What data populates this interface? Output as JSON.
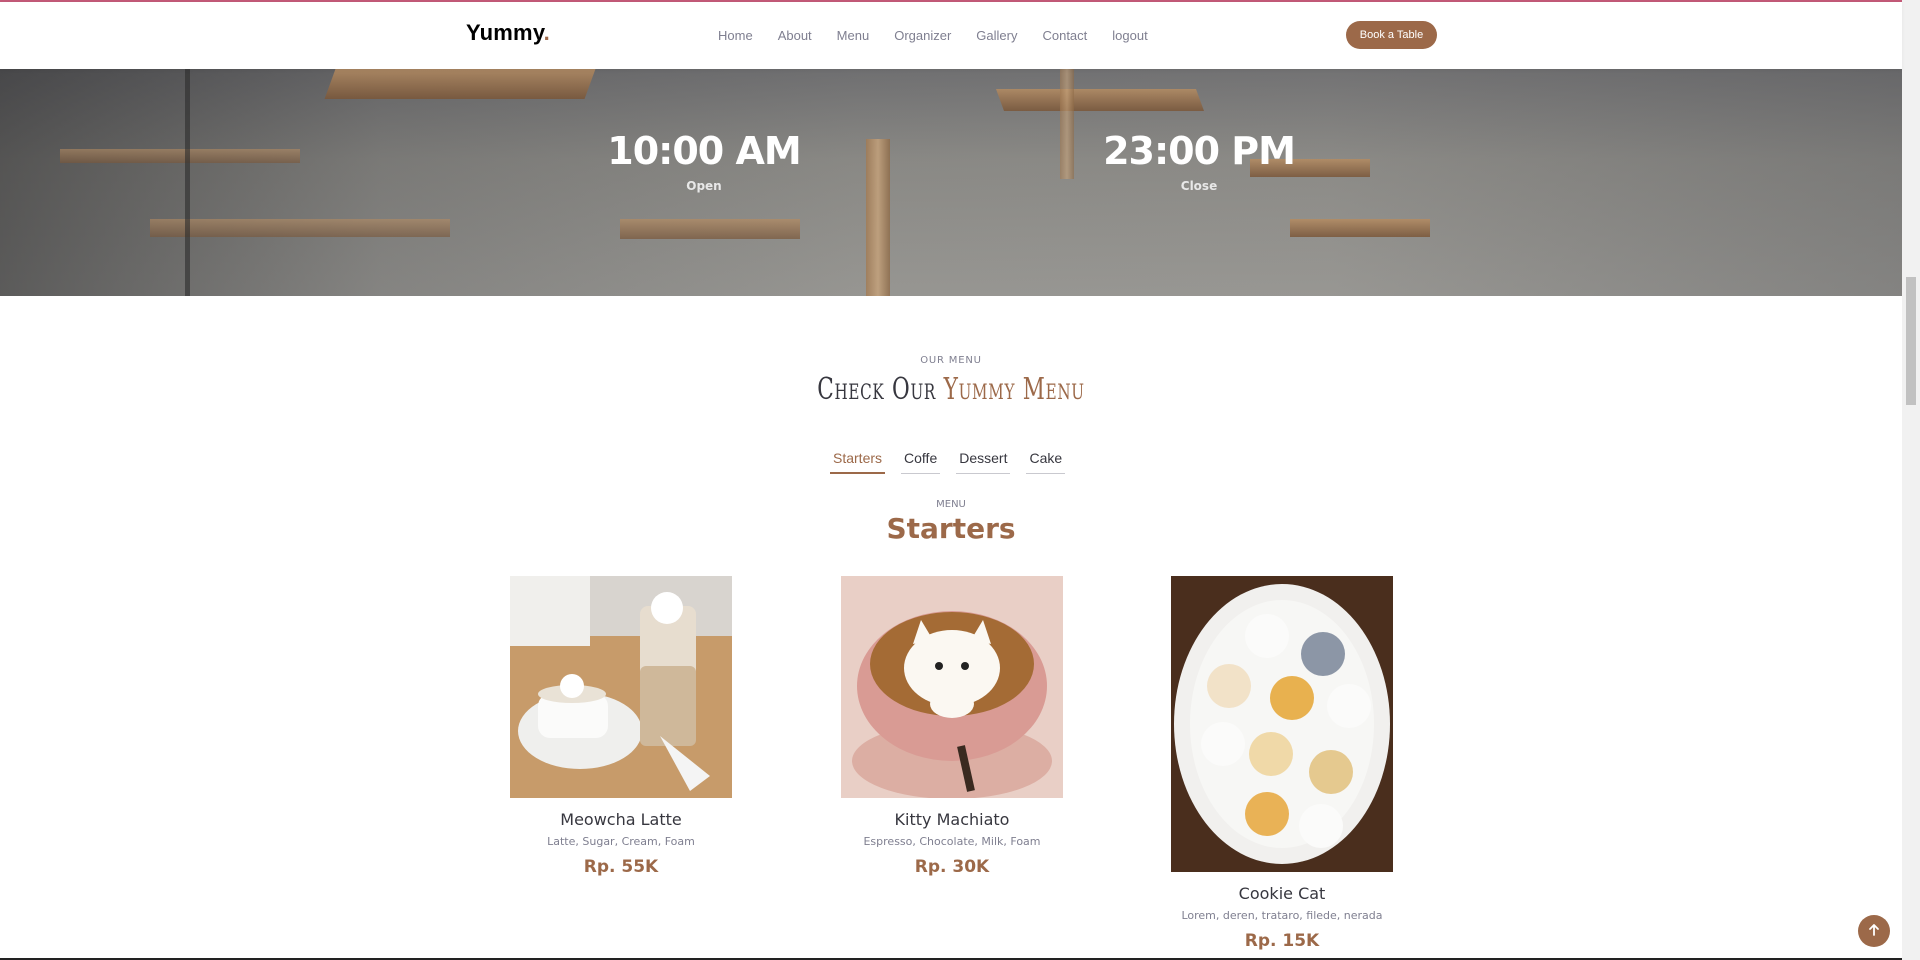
{
  "header": {
    "logo_text": "Yummy",
    "logo_dot": ".",
    "nav": [
      {
        "label": "Home"
      },
      {
        "label": "About"
      },
      {
        "label": "Menu"
      },
      {
        "label": "Organizer"
      },
      {
        "label": "Gallery"
      },
      {
        "label": "Contact"
      },
      {
        "label": "logout"
      }
    ],
    "book_label": "Book a Table"
  },
  "hours": {
    "open_time": "10:00 AM",
    "open_label": "Open",
    "close_time": "23:00 PM",
    "close_label": "Close"
  },
  "menu_section": {
    "subtitle": "OUR MENU",
    "title_part1": "Check Our",
    "title_part2": "Yummy Menu",
    "tabs": [
      {
        "label": "Starters",
        "active": true
      },
      {
        "label": "Coffe",
        "active": false
      },
      {
        "label": "Dessert",
        "active": false
      },
      {
        "label": "Cake",
        "active": false
      }
    ],
    "panel_label": "MENU",
    "panel_heading": "Starters",
    "items": [
      {
        "name": "Meowcha Latte",
        "ingredients": "Latte, Sugar, Cream, Foam",
        "price": "Rp. 55K"
      },
      {
        "name": "Kitty Machiato",
        "ingredients": "Espresso, Chocolate, Milk, Foam",
        "price": "Rp. 30K"
      },
      {
        "name": "Cookie Cat",
        "ingredients": "Lorem, deren, trataro, filede, nerada",
        "price": "Rp. 15K"
      }
    ]
  },
  "colors": {
    "accent": "#9c6949",
    "text": "#37373f",
    "muted": "#7f7f90"
  },
  "icons": {
    "scroll_top": "arrow-up-icon"
  }
}
